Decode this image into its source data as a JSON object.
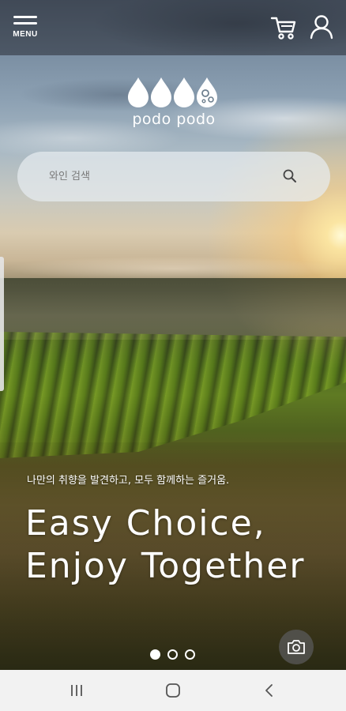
{
  "header": {
    "menu_label": "MENU",
    "menu_icon": "hamburger-icon",
    "cart_icon": "cart-icon",
    "account_icon": "user-icon"
  },
  "brand": {
    "logo_text": "podo podo",
    "logo_icon": "grape-drops-logo"
  },
  "search": {
    "placeholder": "와인 검색",
    "value": "",
    "icon": "search-icon"
  },
  "hero": {
    "tagline": "나만의 취향을 발견하고, 모두 함께하는 즐거움.",
    "headline_line1": "Easy Choice,",
    "headline_line2": "Enjoy Together"
  },
  "carousel": {
    "slide_count": 3,
    "active_index": 0
  },
  "camera": {
    "icon": "camera-icon"
  },
  "system_nav": {
    "recents_icon": "recents-icon",
    "home_icon": "home-icon",
    "back_icon": "back-icon"
  },
  "colors": {
    "nav_background": "#f2f2f2",
    "top_bar_overlay": "#282c34",
    "text_light": "#ffffff"
  }
}
